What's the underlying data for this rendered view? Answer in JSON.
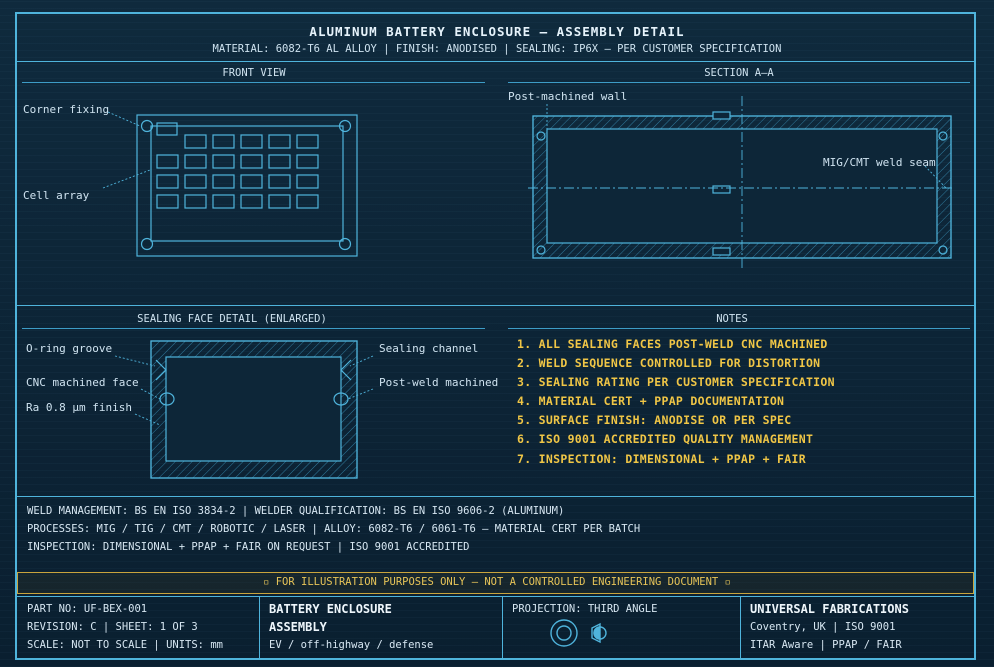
{
  "header": {
    "title": "ALUMINUM BATTERY ENCLOSURE — ASSEMBLY DETAIL",
    "subtitle": "MATERIAL: 6082-T6 AL ALLOY | FINISH: ANODISED | SEALING: IP6X — PER CUSTOMER SPECIFICATION"
  },
  "front_view": {
    "heading": "FRONT VIEW",
    "callouts": [
      "Corner fixing",
      "Cell array"
    ]
  },
  "section_aa": {
    "heading": "SECTION A–A",
    "callouts": [
      "Post-machined wall",
      "MIG/CMT weld seam"
    ]
  },
  "sealing_detail": {
    "heading": "SEALING FACE DETAIL (ENLARGED)",
    "callouts_left": [
      "O-ring groove",
      "CNC machined face",
      "Ra 0.8 µm finish"
    ],
    "callouts_right": [
      "Sealing channel",
      "Post-weld machined"
    ]
  },
  "notes": {
    "heading": "NOTES",
    "items": [
      "1. ALL SEALING FACES POST-WELD CNC MACHINED",
      "2. WELD SEQUENCE CONTROLLED FOR DISTORTION",
      "3. SEALING RATING PER CUSTOMER SPECIFICATION",
      "4. MATERIAL CERT + PPAP DOCUMENTATION",
      "5. SURFACE FINISH: ANODISE OR PER SPEC",
      "6. ISO 9001 ACCREDITED QUALITY MANAGEMENT",
      "7. INSPECTION: DIMENSIONAL + PPAP + FAIR"
    ]
  },
  "specs": [
    "WELD MANAGEMENT: BS EN ISO 3834-2 | WELDER QUALIFICATION: BS EN ISO 9606-2 (ALUMINUM)",
    "PROCESSES: MIG / TIG / CMT / ROBOTIC / LASER | ALLOY: 6082-T6 / 6061-T6 — MATERIAL CERT PER BATCH",
    "INSPECTION: DIMENSIONAL + PPAP + FAIR ON REQUEST | ISO 9001 ACCREDITED"
  ],
  "disclaimer": "▫ FOR ILLUSTRATION PURPOSES ONLY — NOT A CONTROLLED ENGINEERING DOCUMENT ▫",
  "title_block": {
    "part_no": "PART NO: UF-BEX-001",
    "revision": "REVISION: C | SHEET: 1 OF 3",
    "scale": "SCALE: NOT TO SCALE | UNITS: mm",
    "product_line1": "BATTERY ENCLOSURE",
    "product_line2": "ASSEMBLY",
    "product_sub": "EV / off-highway / defense",
    "projection": "PROJECTION: THIRD ANGLE",
    "company": "UNIVERSAL FABRICATIONS",
    "location": "Coventry, UK | ISO 9001",
    "capabilities": "ITAR Aware | PPAP / FAIR"
  },
  "colors": {
    "line": "#4fb4dc",
    "text": "#cfe3f0",
    "notes": "#f0c646",
    "background": "#0b2233"
  }
}
